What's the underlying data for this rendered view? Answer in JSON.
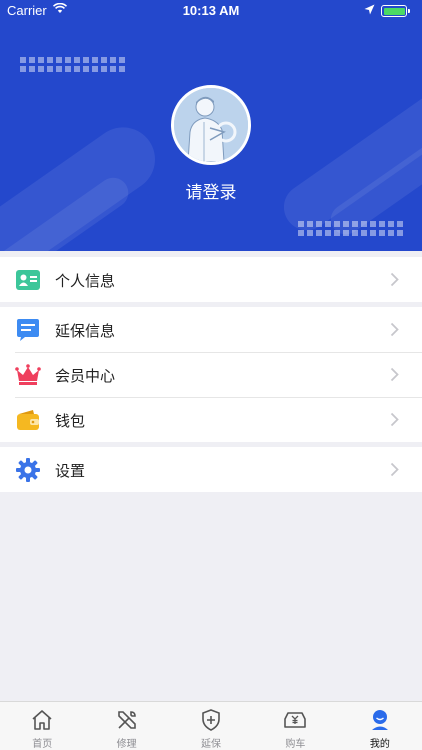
{
  "status_bar": {
    "carrier": "Carrier",
    "time": "10:13 AM"
  },
  "profile": {
    "login_prompt": "请登录"
  },
  "menu": {
    "groups": [
      [
        {
          "label": "个人信息",
          "icon": "id-card-icon"
        }
      ],
      [
        {
          "label": "延保信息",
          "icon": "message-icon"
        },
        {
          "label": "会员中心",
          "icon": "crown-icon"
        },
        {
          "label": "钱包",
          "icon": "wallet-icon"
        }
      ],
      [
        {
          "label": "设置",
          "icon": "gear-icon"
        }
      ]
    ]
  },
  "tabbar": {
    "items": [
      {
        "label": "首页",
        "icon": "home-icon"
      },
      {
        "label": "修理",
        "icon": "repair-tools-icon"
      },
      {
        "label": "延保",
        "icon": "shield-plus-icon"
      },
      {
        "label": "购车",
        "icon": "car-purchase-icon"
      },
      {
        "label": "我的",
        "icon": "profile-icon",
        "active": true
      }
    ]
  },
  "colors": {
    "header_bg": "#2448cc",
    "battery": "#4cd964",
    "id_card": "#3cc69a",
    "message": "#3d8bf2",
    "crown": "#ef3f5d",
    "wallet": "#f5b821",
    "gear": "#3a73e8",
    "tab_active": "#2a6bea"
  }
}
